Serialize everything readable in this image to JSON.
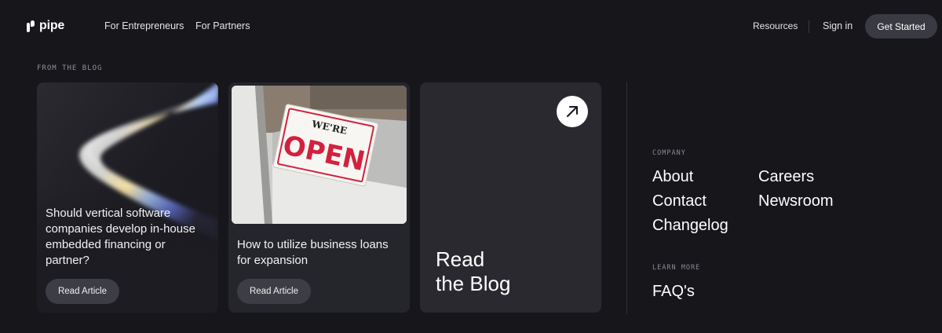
{
  "nav": {
    "logo_text": "pipe",
    "links": [
      "For Entrepreneurs",
      "For Partners"
    ],
    "resources": "Resources",
    "sign_in": "Sign in",
    "get_started": "Get Started"
  },
  "blog": {
    "section_label": "FROM THE BLOG",
    "articles": [
      {
        "title": "Should vertical software companies develop in-house embedded financing or partner?",
        "button": "Read Article"
      },
      {
        "title": "How to utilize business loans for expansion",
        "button": "Read Article",
        "image_sign": {
          "top": "WE'RE",
          "main": "OPEN"
        }
      }
    ],
    "cta": {
      "line1": "Read",
      "line2": "the Blog",
      "icon": "arrow-up-right-icon"
    }
  },
  "footer": {
    "company_label": "COMPANY",
    "company_links": [
      "About",
      "Careers",
      "Contact",
      "Newsroom",
      "Changelog"
    ],
    "learn_label": "LEARN MORE",
    "learn_links": [
      "FAQ's"
    ]
  },
  "colors": {
    "background": "#16161b",
    "card": "#25252c",
    "button": "#3d3d45",
    "sign_red": "#d2213f"
  }
}
